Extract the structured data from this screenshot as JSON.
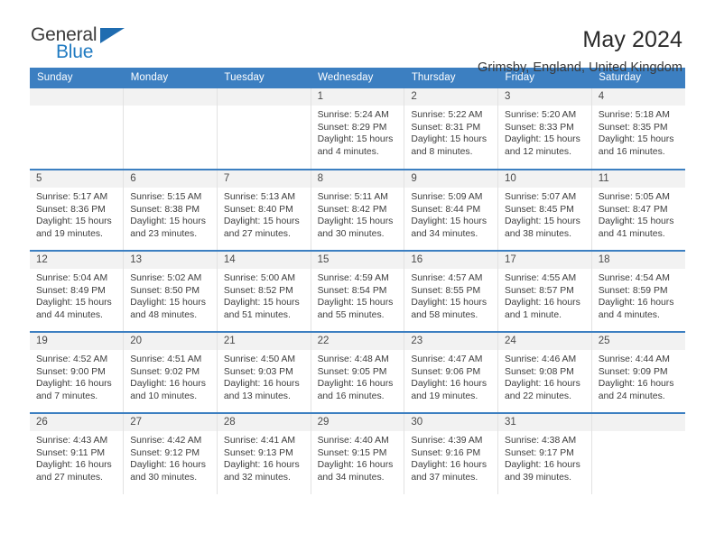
{
  "brand": {
    "name_part1": "General",
    "name_part2": "Blue",
    "triangle_icon": "triangle-icon",
    "color_blue": "#1f7ac1",
    "color_dark": "#3b3b3b"
  },
  "header": {
    "title": "May 2024",
    "subtitle": "Grimsby, England, United Kingdom",
    "accent_color": "#3c7fc1"
  },
  "weekday_headers": [
    "Sunday",
    "Monday",
    "Tuesday",
    "Wednesday",
    "Thursday",
    "Friday",
    "Saturday"
  ],
  "weeks": [
    [
      {
        "day": "",
        "sunrise": "",
        "sunset": "",
        "daylight_line1": "",
        "daylight_line2": ""
      },
      {
        "day": "",
        "sunrise": "",
        "sunset": "",
        "daylight_line1": "",
        "daylight_line2": ""
      },
      {
        "day": "",
        "sunrise": "",
        "sunset": "",
        "daylight_line1": "",
        "daylight_line2": ""
      },
      {
        "day": "1",
        "sunrise": "Sunrise: 5:24 AM",
        "sunset": "Sunset: 8:29 PM",
        "daylight_line1": "Daylight: 15 hours",
        "daylight_line2": "and 4 minutes."
      },
      {
        "day": "2",
        "sunrise": "Sunrise: 5:22 AM",
        "sunset": "Sunset: 8:31 PM",
        "daylight_line1": "Daylight: 15 hours",
        "daylight_line2": "and 8 minutes."
      },
      {
        "day": "3",
        "sunrise": "Sunrise: 5:20 AM",
        "sunset": "Sunset: 8:33 PM",
        "daylight_line1": "Daylight: 15 hours",
        "daylight_line2": "and 12 minutes."
      },
      {
        "day": "4",
        "sunrise": "Sunrise: 5:18 AM",
        "sunset": "Sunset: 8:35 PM",
        "daylight_line1": "Daylight: 15 hours",
        "daylight_line2": "and 16 minutes."
      }
    ],
    [
      {
        "day": "5",
        "sunrise": "Sunrise: 5:17 AM",
        "sunset": "Sunset: 8:36 PM",
        "daylight_line1": "Daylight: 15 hours",
        "daylight_line2": "and 19 minutes."
      },
      {
        "day": "6",
        "sunrise": "Sunrise: 5:15 AM",
        "sunset": "Sunset: 8:38 PM",
        "daylight_line1": "Daylight: 15 hours",
        "daylight_line2": "and 23 minutes."
      },
      {
        "day": "7",
        "sunrise": "Sunrise: 5:13 AM",
        "sunset": "Sunset: 8:40 PM",
        "daylight_line1": "Daylight: 15 hours",
        "daylight_line2": "and 27 minutes."
      },
      {
        "day": "8",
        "sunrise": "Sunrise: 5:11 AM",
        "sunset": "Sunset: 8:42 PM",
        "daylight_line1": "Daylight: 15 hours",
        "daylight_line2": "and 30 minutes."
      },
      {
        "day": "9",
        "sunrise": "Sunrise: 5:09 AM",
        "sunset": "Sunset: 8:44 PM",
        "daylight_line1": "Daylight: 15 hours",
        "daylight_line2": "and 34 minutes."
      },
      {
        "day": "10",
        "sunrise": "Sunrise: 5:07 AM",
        "sunset": "Sunset: 8:45 PM",
        "daylight_line1": "Daylight: 15 hours",
        "daylight_line2": "and 38 minutes."
      },
      {
        "day": "11",
        "sunrise": "Sunrise: 5:05 AM",
        "sunset": "Sunset: 8:47 PM",
        "daylight_line1": "Daylight: 15 hours",
        "daylight_line2": "and 41 minutes."
      }
    ],
    [
      {
        "day": "12",
        "sunrise": "Sunrise: 5:04 AM",
        "sunset": "Sunset: 8:49 PM",
        "daylight_line1": "Daylight: 15 hours",
        "daylight_line2": "and 44 minutes."
      },
      {
        "day": "13",
        "sunrise": "Sunrise: 5:02 AM",
        "sunset": "Sunset: 8:50 PM",
        "daylight_line1": "Daylight: 15 hours",
        "daylight_line2": "and 48 minutes."
      },
      {
        "day": "14",
        "sunrise": "Sunrise: 5:00 AM",
        "sunset": "Sunset: 8:52 PM",
        "daylight_line1": "Daylight: 15 hours",
        "daylight_line2": "and 51 minutes."
      },
      {
        "day": "15",
        "sunrise": "Sunrise: 4:59 AM",
        "sunset": "Sunset: 8:54 PM",
        "daylight_line1": "Daylight: 15 hours",
        "daylight_line2": "and 55 minutes."
      },
      {
        "day": "16",
        "sunrise": "Sunrise: 4:57 AM",
        "sunset": "Sunset: 8:55 PM",
        "daylight_line1": "Daylight: 15 hours",
        "daylight_line2": "and 58 minutes."
      },
      {
        "day": "17",
        "sunrise": "Sunrise: 4:55 AM",
        "sunset": "Sunset: 8:57 PM",
        "daylight_line1": "Daylight: 16 hours",
        "daylight_line2": "and 1 minute."
      },
      {
        "day": "18",
        "sunrise": "Sunrise: 4:54 AM",
        "sunset": "Sunset: 8:59 PM",
        "daylight_line1": "Daylight: 16 hours",
        "daylight_line2": "and 4 minutes."
      }
    ],
    [
      {
        "day": "19",
        "sunrise": "Sunrise: 4:52 AM",
        "sunset": "Sunset: 9:00 PM",
        "daylight_line1": "Daylight: 16 hours",
        "daylight_line2": "and 7 minutes."
      },
      {
        "day": "20",
        "sunrise": "Sunrise: 4:51 AM",
        "sunset": "Sunset: 9:02 PM",
        "daylight_line1": "Daylight: 16 hours",
        "daylight_line2": "and 10 minutes."
      },
      {
        "day": "21",
        "sunrise": "Sunrise: 4:50 AM",
        "sunset": "Sunset: 9:03 PM",
        "daylight_line1": "Daylight: 16 hours",
        "daylight_line2": "and 13 minutes."
      },
      {
        "day": "22",
        "sunrise": "Sunrise: 4:48 AM",
        "sunset": "Sunset: 9:05 PM",
        "daylight_line1": "Daylight: 16 hours",
        "daylight_line2": "and 16 minutes."
      },
      {
        "day": "23",
        "sunrise": "Sunrise: 4:47 AM",
        "sunset": "Sunset: 9:06 PM",
        "daylight_line1": "Daylight: 16 hours",
        "daylight_line2": "and 19 minutes."
      },
      {
        "day": "24",
        "sunrise": "Sunrise: 4:46 AM",
        "sunset": "Sunset: 9:08 PM",
        "daylight_line1": "Daylight: 16 hours",
        "daylight_line2": "and 22 minutes."
      },
      {
        "day": "25",
        "sunrise": "Sunrise: 4:44 AM",
        "sunset": "Sunset: 9:09 PM",
        "daylight_line1": "Daylight: 16 hours",
        "daylight_line2": "and 24 minutes."
      }
    ],
    [
      {
        "day": "26",
        "sunrise": "Sunrise: 4:43 AM",
        "sunset": "Sunset: 9:11 PM",
        "daylight_line1": "Daylight: 16 hours",
        "daylight_line2": "and 27 minutes."
      },
      {
        "day": "27",
        "sunrise": "Sunrise: 4:42 AM",
        "sunset": "Sunset: 9:12 PM",
        "daylight_line1": "Daylight: 16 hours",
        "daylight_line2": "and 30 minutes."
      },
      {
        "day": "28",
        "sunrise": "Sunrise: 4:41 AM",
        "sunset": "Sunset: 9:13 PM",
        "daylight_line1": "Daylight: 16 hours",
        "daylight_line2": "and 32 minutes."
      },
      {
        "day": "29",
        "sunrise": "Sunrise: 4:40 AM",
        "sunset": "Sunset: 9:15 PM",
        "daylight_line1": "Daylight: 16 hours",
        "daylight_line2": "and 34 minutes."
      },
      {
        "day": "30",
        "sunrise": "Sunrise: 4:39 AM",
        "sunset": "Sunset: 9:16 PM",
        "daylight_line1": "Daylight: 16 hours",
        "daylight_line2": "and 37 minutes."
      },
      {
        "day": "31",
        "sunrise": "Sunrise: 4:38 AM",
        "sunset": "Sunset: 9:17 PM",
        "daylight_line1": "Daylight: 16 hours",
        "daylight_line2": "and 39 minutes."
      },
      {
        "day": "",
        "sunrise": "",
        "sunset": "",
        "daylight_line1": "",
        "daylight_line2": ""
      }
    ]
  ]
}
